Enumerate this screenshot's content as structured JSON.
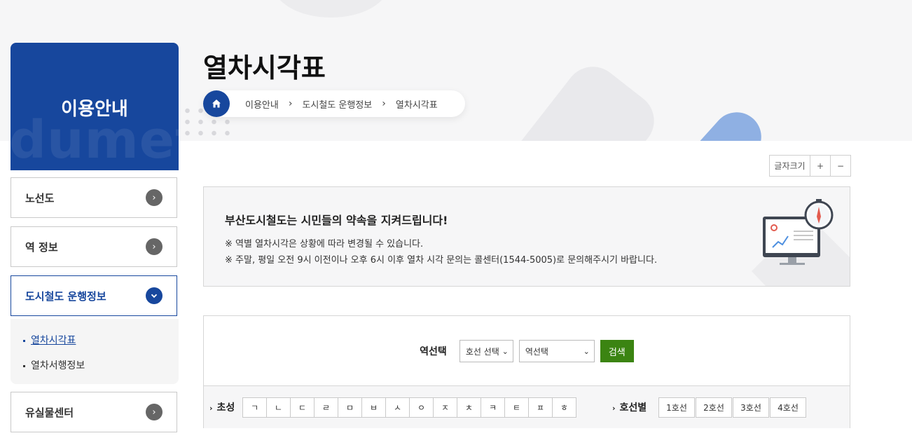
{
  "page": {
    "title": "열차시각표"
  },
  "sidebar": {
    "title": "이용안내",
    "watermark": "dumetro",
    "menu": [
      {
        "label": "노선도",
        "state": "collapsed"
      },
      {
        "label": "역 정보",
        "state": "collapsed"
      },
      {
        "label": "도시철도 운행정보",
        "state": "expanded"
      },
      {
        "label": "유실물센터",
        "state": "collapsed"
      }
    ],
    "submenu": [
      {
        "label": "열차시각표",
        "current": true
      },
      {
        "label": "열차서행정보",
        "current": false
      }
    ]
  },
  "breadcrumb": [
    "이용안내",
    "도시철도 운행정보",
    "열차시각표"
  ],
  "font_size_control": {
    "label": "글자크기",
    "plus": "+",
    "minus": "−"
  },
  "notice": {
    "title": "부산도시철도는 시민들의 약속을 지켜드립니다!",
    "lines": [
      "※ 역별 열차시각은 상황에 따라 변경될 수 있습니다.",
      "※ 주말, 평일 오전 9시 이전이나 오후 6시 이후 열차 시각 문의는 콜센터(1544-5005)로 문의해주시기 바랍니다."
    ]
  },
  "search": {
    "label": "역선택",
    "line_select": "호선 선택",
    "station_select": "역선택",
    "button": "검색",
    "initial_label": "초성",
    "initials": [
      "ㄱ",
      "ㄴ",
      "ㄷ",
      "ㄹ",
      "ㅁ",
      "ㅂ",
      "ㅅ",
      "ㅇ",
      "ㅈ",
      "ㅊ",
      "ㅋ",
      "ㅌ",
      "ㅍ",
      "ㅎ"
    ],
    "line_label": "호선별",
    "lines": [
      "1호선",
      "2호선",
      "3호선",
      "4호선"
    ]
  },
  "colors": {
    "primary": "#17479d",
    "search_button": "#3b8412",
    "accent_blue": "#8fb0e3"
  },
  "icons": [
    "home-icon",
    "chevron-right-icon",
    "chevron-down-icon",
    "monitor-clock-illustration"
  ]
}
